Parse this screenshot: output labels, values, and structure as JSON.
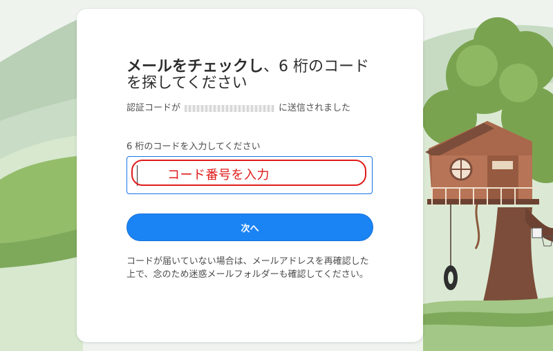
{
  "card": {
    "title_bold": "メールをチェックし",
    "title_rest": "、6 桁のコードを探してください",
    "sent_prefix": "認証コードが",
    "sent_suffix": "に送信されました",
    "code_label": "6 桁のコードを入力してください",
    "code_value": "",
    "annotation": "コード番号を入力",
    "next_label": "次へ",
    "help_text": "コードが届いていない場合は、メールアドレスを再確認した上で、念のため迷惑メールフォルダーも確認してください。"
  },
  "colors": {
    "accent": "#1a84f5",
    "annotation": "#e01a1a",
    "hill": "#b7cfb3",
    "grass": "#8eb86a",
    "tree": "#7aa350",
    "trunk": "#7b4d3a",
    "house": "#a9684b"
  }
}
